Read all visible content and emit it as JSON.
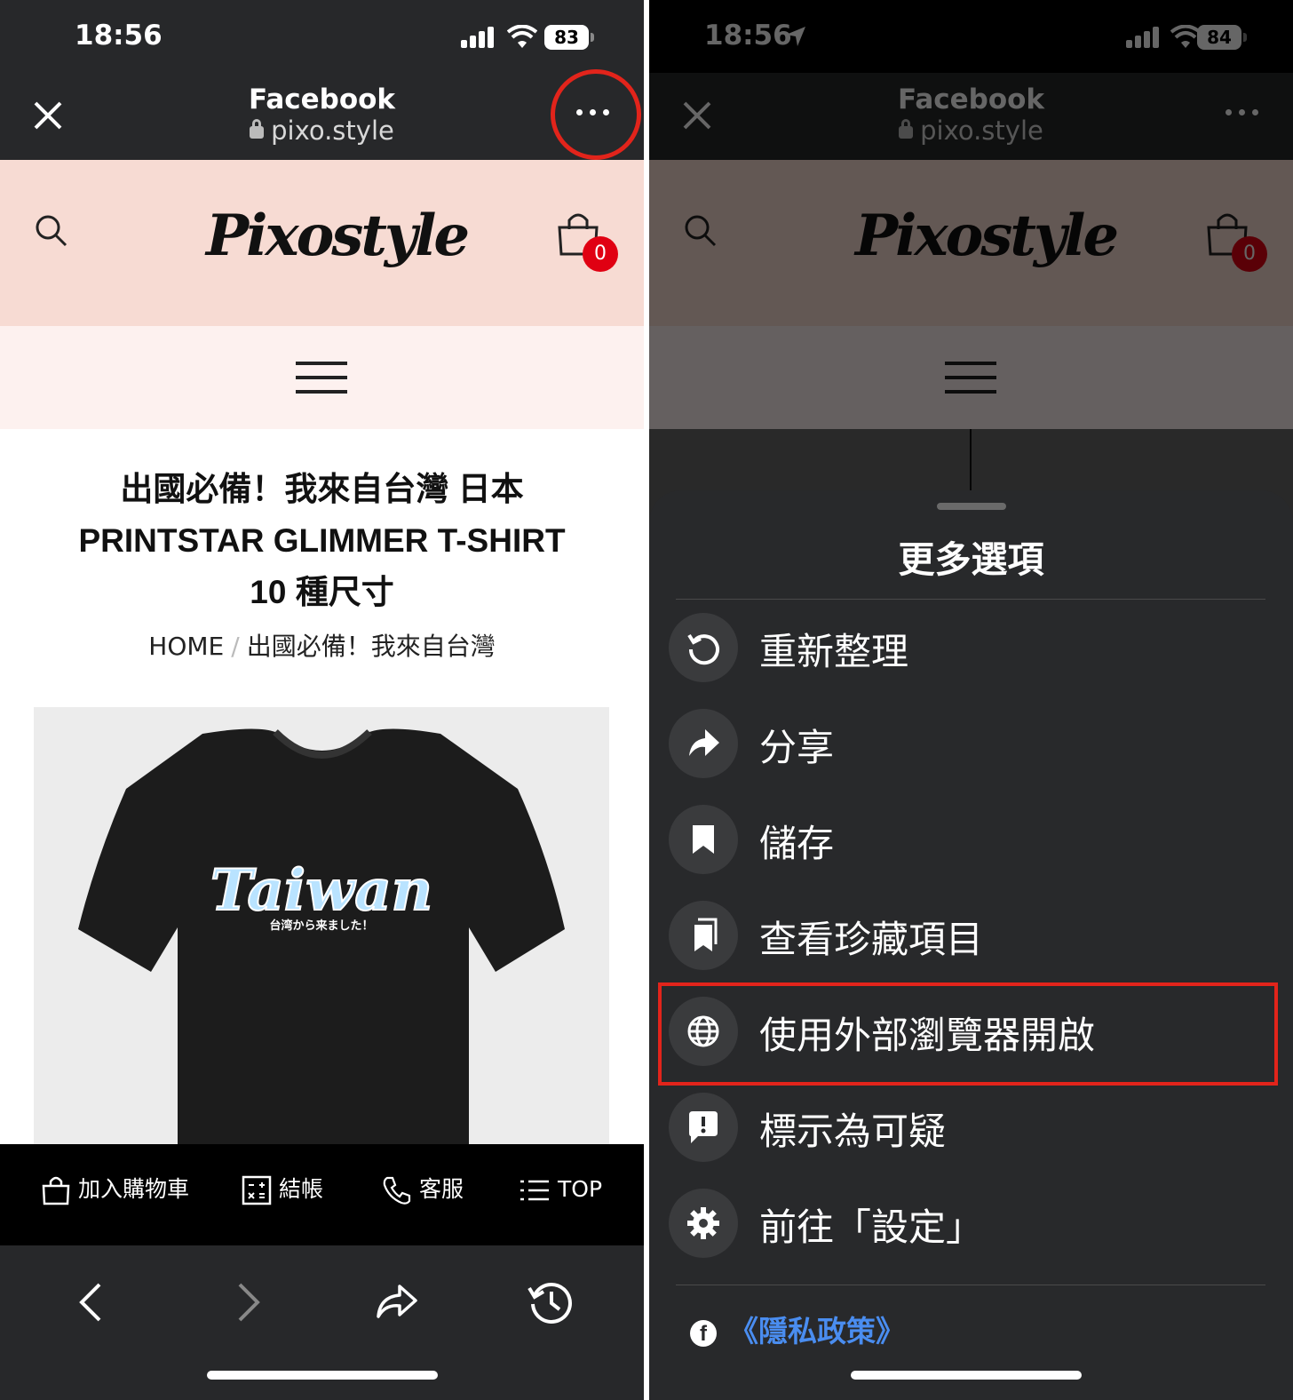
{
  "left": {
    "status": {
      "time": "18:56",
      "battery": "83"
    },
    "browser": {
      "title": "Facebook",
      "url": "pixo.style"
    },
    "site": {
      "logo": "Pixostyle",
      "cart_count": "0"
    },
    "product": {
      "title_line1": "出國必備！我來自台灣 日本",
      "title_line2": "PRINTSTAR GLIMMER T-SHIRT",
      "title_line3": "10 種尺寸",
      "breadcrumb_home": "HOME",
      "breadcrumb_sep": "/",
      "breadcrumb_current": "出國必備！我來自台灣",
      "shirt_text": "Taiwan",
      "shirt_subtext": "台湾から来ました！"
    },
    "footer": {
      "add_to_cart": "加入購物車",
      "checkout": "結帳",
      "service": "客服",
      "top": "TOP"
    }
  },
  "right": {
    "status": {
      "time": "18:56",
      "battery": "84"
    },
    "browser": {
      "title": "Facebook",
      "url": "pixo.style"
    },
    "site": {
      "logo": "Pixostyle",
      "cart_count": "0"
    },
    "sheet": {
      "title": "更多選項",
      "options": [
        {
          "label": "重新整理",
          "icon": "refresh-icon"
        },
        {
          "label": "分享",
          "icon": "share-icon"
        },
        {
          "label": "儲存",
          "icon": "bookmark-icon"
        },
        {
          "label": "查看珍藏項目",
          "icon": "saved-items-icon"
        },
        {
          "label": "使用外部瀏覽器開啟",
          "icon": "globe-icon"
        },
        {
          "label": "標示為可疑",
          "icon": "report-icon"
        },
        {
          "label": "前往「設定」",
          "icon": "gear-icon"
        }
      ],
      "privacy": "《隱私政策》"
    }
  },
  "colors": {
    "highlight": "#e2241b",
    "header_pink": "#f7dbd3",
    "badge_red": "#e00012",
    "link_blue": "#4a8df0"
  }
}
